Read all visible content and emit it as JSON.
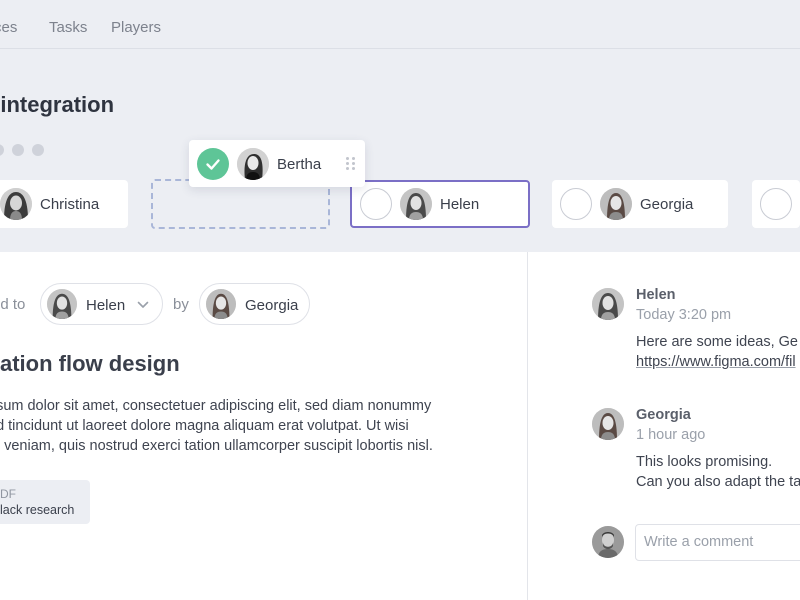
{
  "nav": {
    "items": [
      "ces",
      "Tasks",
      "Players"
    ]
  },
  "header": {
    "title": "k integration"
  },
  "players": {
    "dragging": {
      "name": "Bertha",
      "done": true
    },
    "cards": [
      {
        "name": "Christina"
      },
      {
        "name": "Helen",
        "selected": true
      },
      {
        "name": "Georgia"
      }
    ]
  },
  "task": {
    "assigned_prefix": "ed to",
    "assignee": "Helen",
    "by_label": "by",
    "assigner": "Georgia",
    "title": "gration flow design",
    "description": [
      "psum dolor sit amet, consectetuer adipiscing elit, sed diam nonummy",
      "od tincidunt ut laoreet dolore magna aliquam erat volutpat. Ut wisi",
      "m veniam, quis nostrud exerci tation ullamcorper suscipit lobortis nisl."
    ],
    "attachment": {
      "type": "DF",
      "name": "lack research"
    }
  },
  "comments": [
    {
      "author": "Helen",
      "time": "Today 3:20 pm",
      "lines": [
        "Here are some ideas, Ge",
        "https://www.figma.com/fil"
      ]
    },
    {
      "author": "Georgia",
      "time": "1 hour ago",
      "lines": [
        "This looks promising.",
        "Can you also adapt the ta"
      ]
    }
  ],
  "comment_input": {
    "placeholder": "Write a comment"
  },
  "colors": {
    "accent": "#7b6fc6",
    "success": "#5ec597",
    "header_bg": "#eceef3"
  },
  "icons": {
    "done": "check-icon",
    "grip": "drag-handle-icon",
    "dropdown": "chevron-down-icon"
  }
}
